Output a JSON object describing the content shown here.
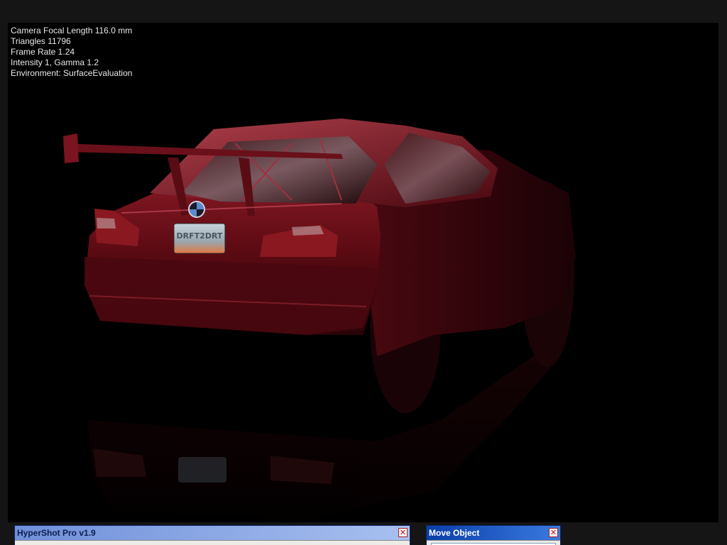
{
  "hud": {
    "focal_length": "Camera Focal Length 116.0 mm",
    "triangles": "Triangles 11796",
    "frame_rate": "Frame Rate 1.24",
    "intensity": "Intensity 1, Gamma 1.2",
    "environment": "Environment: SurfaceEvaluation"
  },
  "car": {
    "plate_text": "DRFT2DRT",
    "paint_color": "#5a0a12"
  },
  "windows": {
    "hypershot": {
      "title": "HyperShot Pro v1.9",
      "close_icon": "close-icon"
    },
    "move_object": {
      "title": "Move Object",
      "close_icon": "close-icon"
    }
  }
}
